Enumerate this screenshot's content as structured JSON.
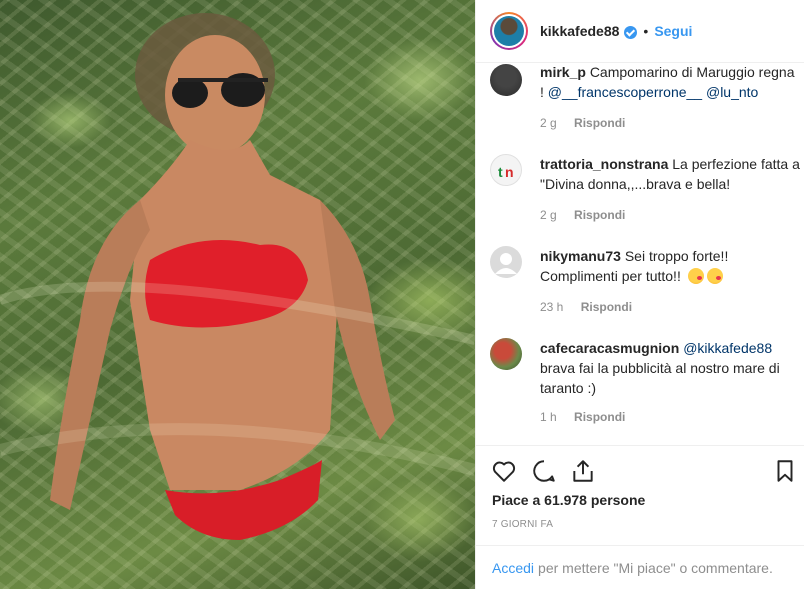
{
  "post": {
    "username": "kikkafede88",
    "follow_label": "Segui",
    "dot": "•"
  },
  "comments": [
    {
      "user": "mirk_p",
      "text": "Campomarino di Maruggio regna !",
      "mentions": [
        "@__francescoperrone__",
        "@lu_nto"
      ],
      "time": "2 g",
      "reply": "Rispondi"
    },
    {
      "user": "trattoria_nonstrana",
      "text": "La perfezione fatta a \"Divina donna,,...brava e bella!",
      "time": "2 g",
      "reply": "Rispondi"
    },
    {
      "user": "nikymanu73",
      "text": "Sei troppo forte!! Complimenti per tutto!!",
      "time": "23 h",
      "reply": "Rispondi"
    },
    {
      "user": "cafecaracasmugnion",
      "mention": "@kikkafede88",
      "text": "brava fai la pubblicità al nostro mare di taranto :)",
      "time": "1 h",
      "reply": "Rispondi"
    }
  ],
  "actions": {
    "likes": "Piace a 61.978 persone",
    "time_ago": "7 GIORNI FA"
  },
  "footer": {
    "login_link": "Accedi",
    "login_text": "per mettere \"Mi piace\" o commentare."
  },
  "icons": [
    "heart-icon",
    "comment-icon",
    "share-icon",
    "bookmark-icon",
    "verified-icon"
  ],
  "colors": {
    "link": "#3897f0",
    "mention": "#003569",
    "muted": "#8e8e8e",
    "border": "#efefef"
  }
}
